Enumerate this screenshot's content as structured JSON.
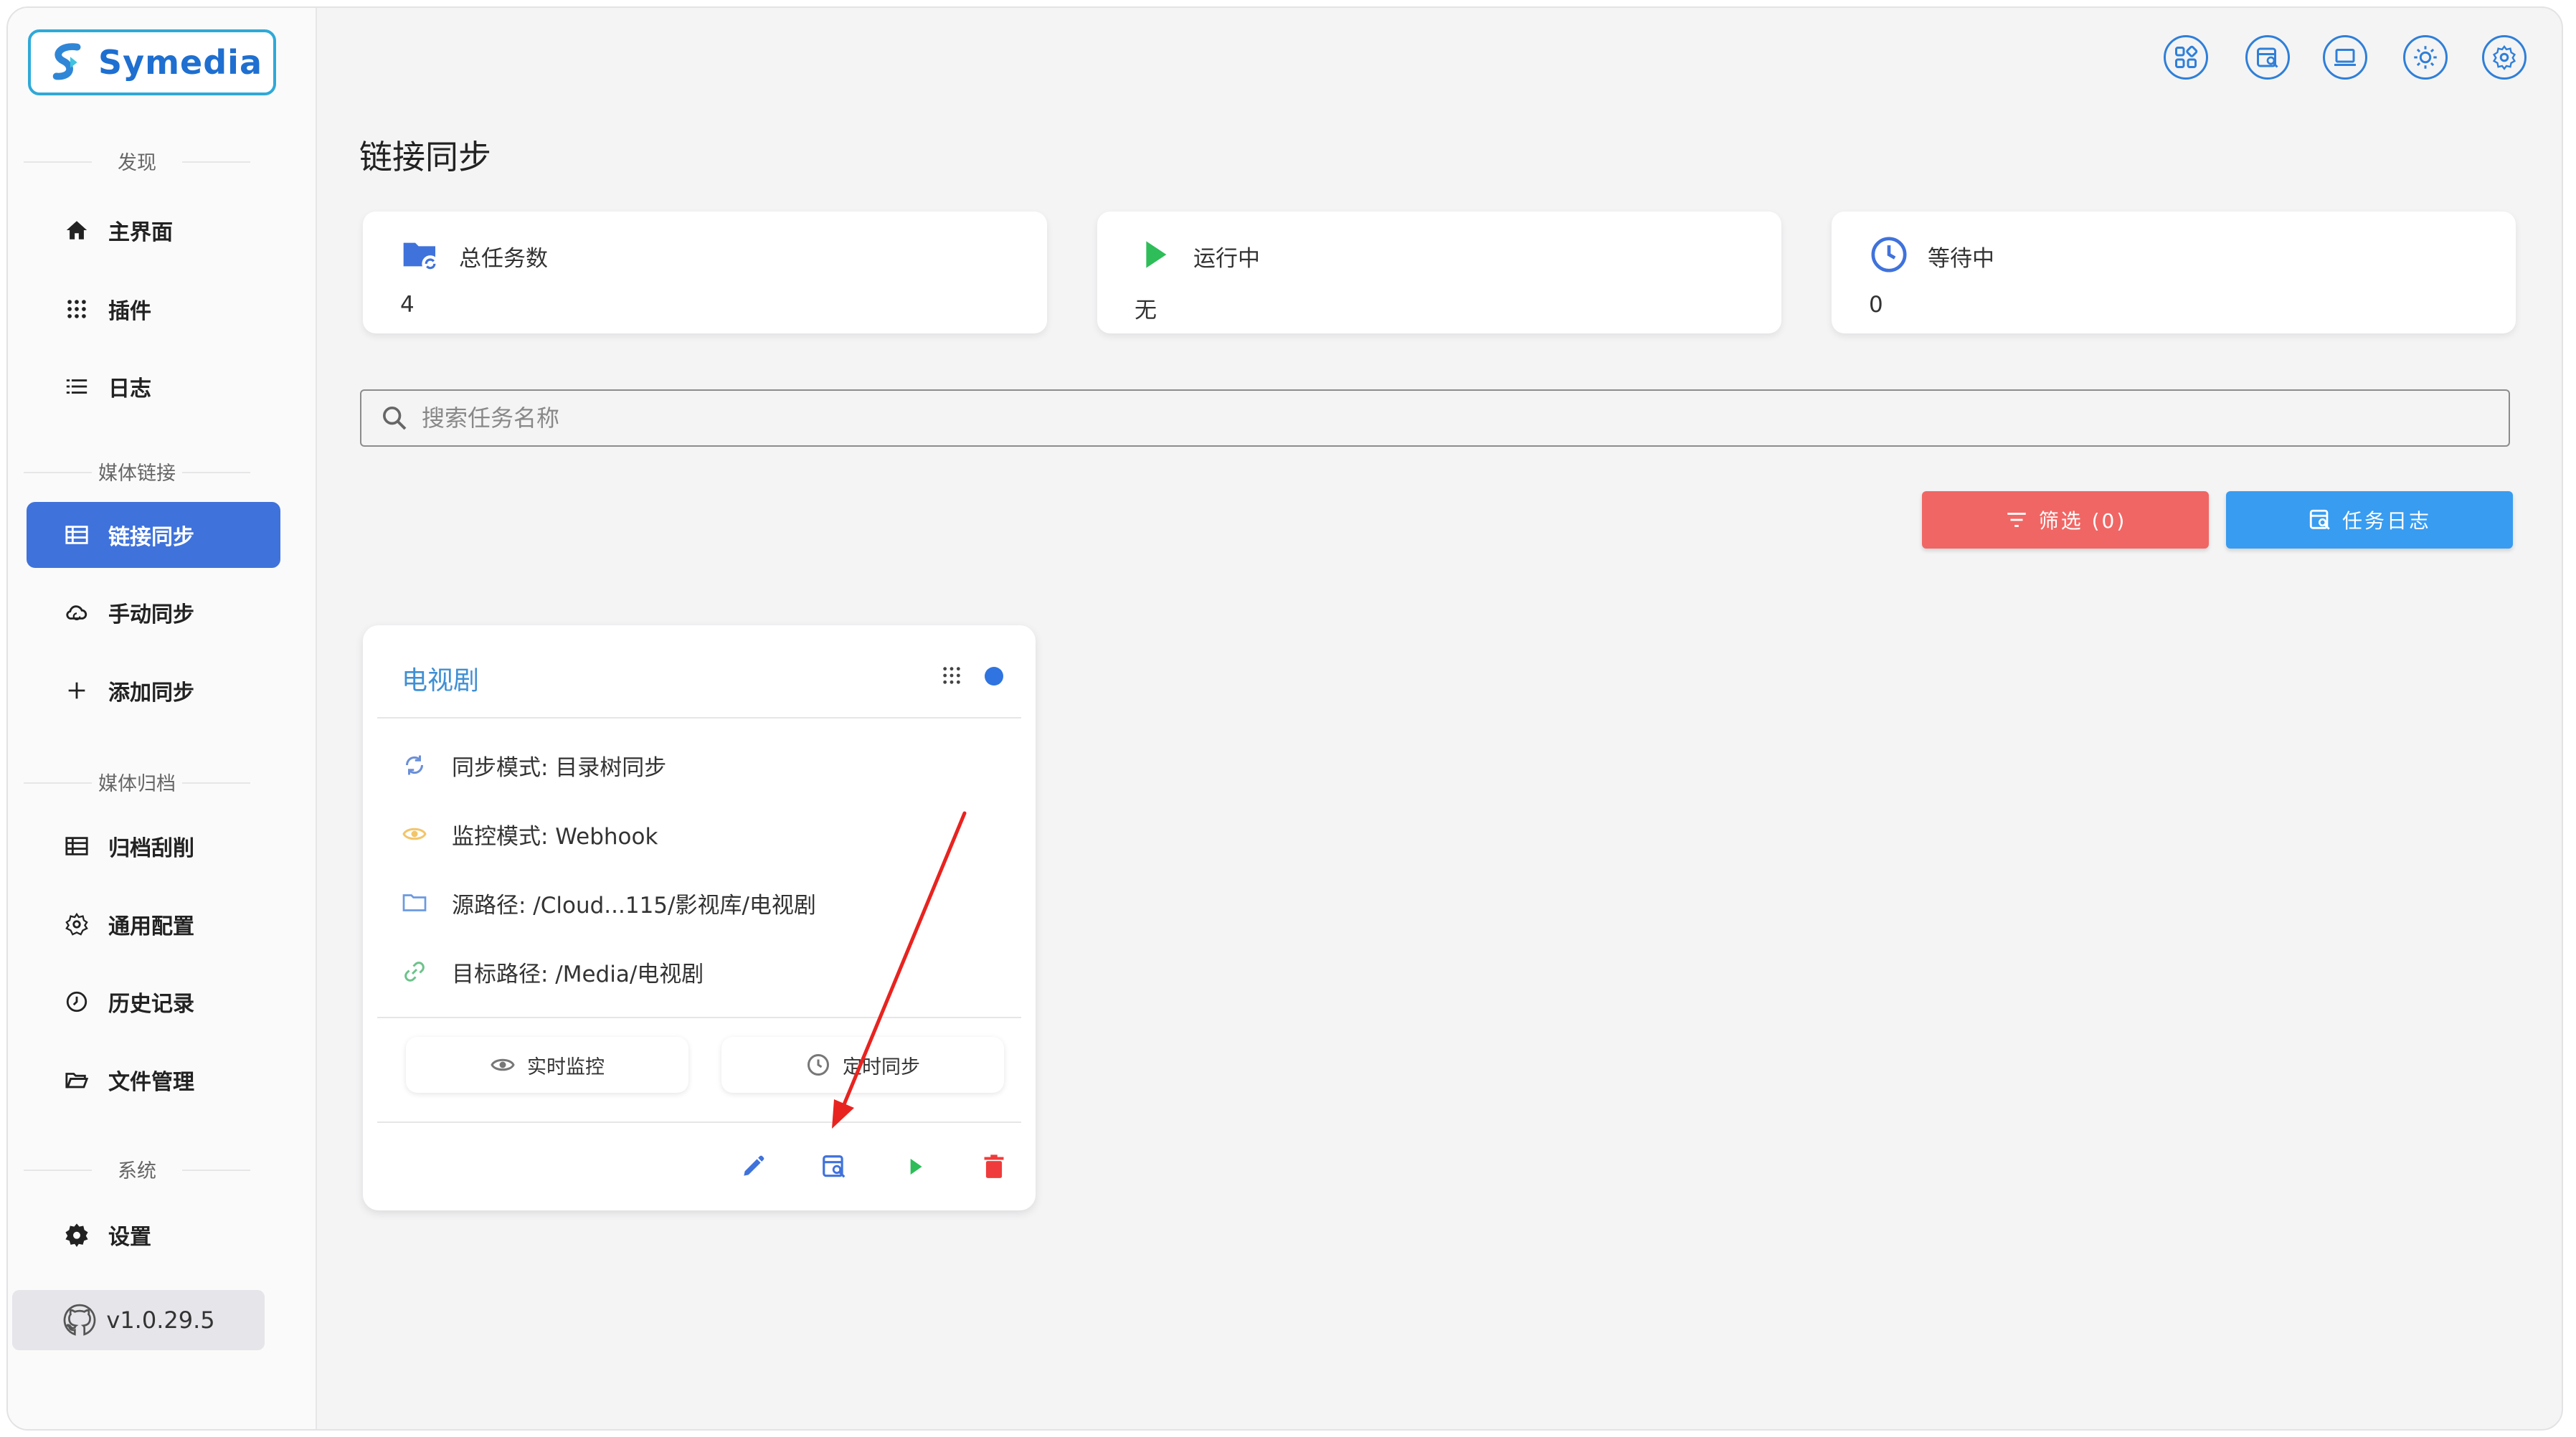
{
  "app": {
    "name": "Symedia",
    "version": "v1.0.29.5"
  },
  "sidebar": {
    "sections": [
      {
        "title": "发现",
        "items": [
          {
            "label": "主界面"
          },
          {
            "label": "插件"
          },
          {
            "label": "日志"
          }
        ]
      },
      {
        "title": "媒体链接",
        "items": [
          {
            "label": "链接同步"
          },
          {
            "label": "手动同步"
          },
          {
            "label": "添加同步"
          }
        ]
      },
      {
        "title": "媒体归档",
        "items": [
          {
            "label": "归档刮削"
          },
          {
            "label": "通用配置"
          },
          {
            "label": "历史记录"
          },
          {
            "label": "文件管理"
          }
        ]
      },
      {
        "title": "系统",
        "items": [
          {
            "label": "设置"
          }
        ]
      }
    ],
    "active": "链接同步"
  },
  "page": {
    "title": "链接同步"
  },
  "stats": [
    {
      "label": "总任务数",
      "value": "4"
    },
    {
      "label": "运行中",
      "value": "无"
    },
    {
      "label": "等待中",
      "value": "0"
    }
  ],
  "search": {
    "placeholder": "搜索任务名称",
    "value": ""
  },
  "toolbar": {
    "filter_label": "筛选 (0)",
    "log_label": "任务日志"
  },
  "task": {
    "name": "电视剧",
    "sync_mode": "同步模式: 目录树同步",
    "monitor_mode": "监控模式: Webhook",
    "source_path": "源路径: /Cloud...115/影视库/电视剧",
    "target_path": "目标路径: /Media/电视剧",
    "realtime_label": "实时监控",
    "scheduled_label": "定时同步"
  },
  "colors": {
    "primary": "#3f72db",
    "filter": "#f06664",
    "log": "#389cf0",
    "title_link": "#3f8fd4",
    "status_dot": "#2f74e0",
    "play": "#2ebd59",
    "delete": "#ef3b3b",
    "annotation_arrow": "#e8231f"
  }
}
